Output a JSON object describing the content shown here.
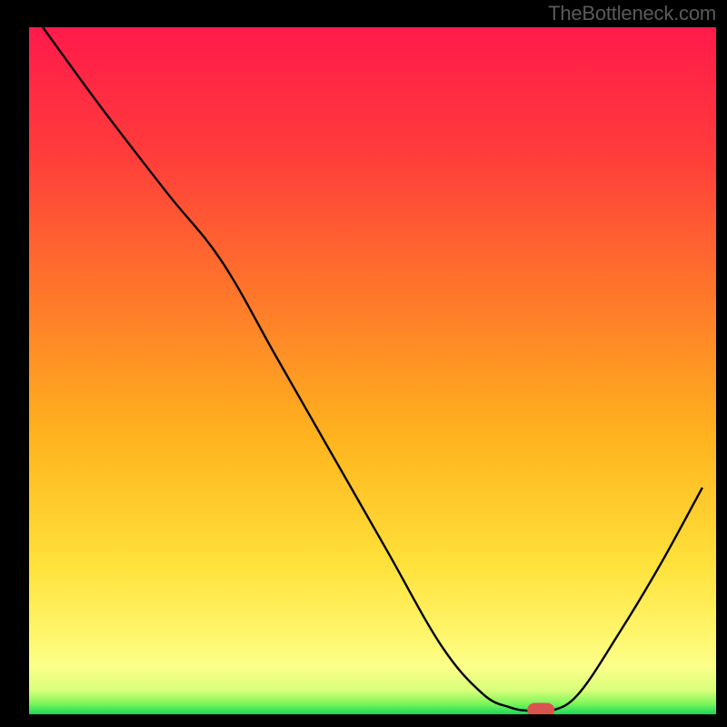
{
  "watermark": "TheBottleneck.com",
  "chart_data": {
    "type": "line",
    "title": "",
    "xlabel": "",
    "ylabel": "",
    "xlim": [
      0,
      100
    ],
    "ylim": [
      0,
      100
    ],
    "grid": false,
    "legend": false,
    "series": [
      {
        "name": "bottleneck-curve",
        "x": [
          2,
          10,
          20,
          28,
          36,
          44,
          52,
          60,
          66,
          70,
          73,
          76,
          80,
          86,
          92,
          98
        ],
        "values": [
          100,
          89,
          76,
          66,
          52,
          38,
          24,
          10,
          3,
          1,
          0.5,
          0.5,
          3,
          12,
          22,
          33
        ]
      }
    ],
    "marker": {
      "x": 74.5,
      "y": 0.6
    },
    "gradient_stops": [
      {
        "offset": 0.0,
        "color": "#ff1a4b"
      },
      {
        "offset": 0.18,
        "color": "#ff3b3b"
      },
      {
        "offset": 0.4,
        "color": "#ff7a2a"
      },
      {
        "offset": 0.6,
        "color": "#ffb41e"
      },
      {
        "offset": 0.78,
        "color": "#ffe13a"
      },
      {
        "offset": 0.88,
        "color": "#fff56a"
      },
      {
        "offset": 0.93,
        "color": "#fcff8a"
      },
      {
        "offset": 0.965,
        "color": "#d9ff7a"
      },
      {
        "offset": 0.985,
        "color": "#7cf55a"
      },
      {
        "offset": 1.0,
        "color": "#17d65c"
      }
    ],
    "frame": {
      "inner_left": 32,
      "inner_top": 30,
      "inner_width": 756,
      "inner_height": 756,
      "border_width": 32
    }
  }
}
